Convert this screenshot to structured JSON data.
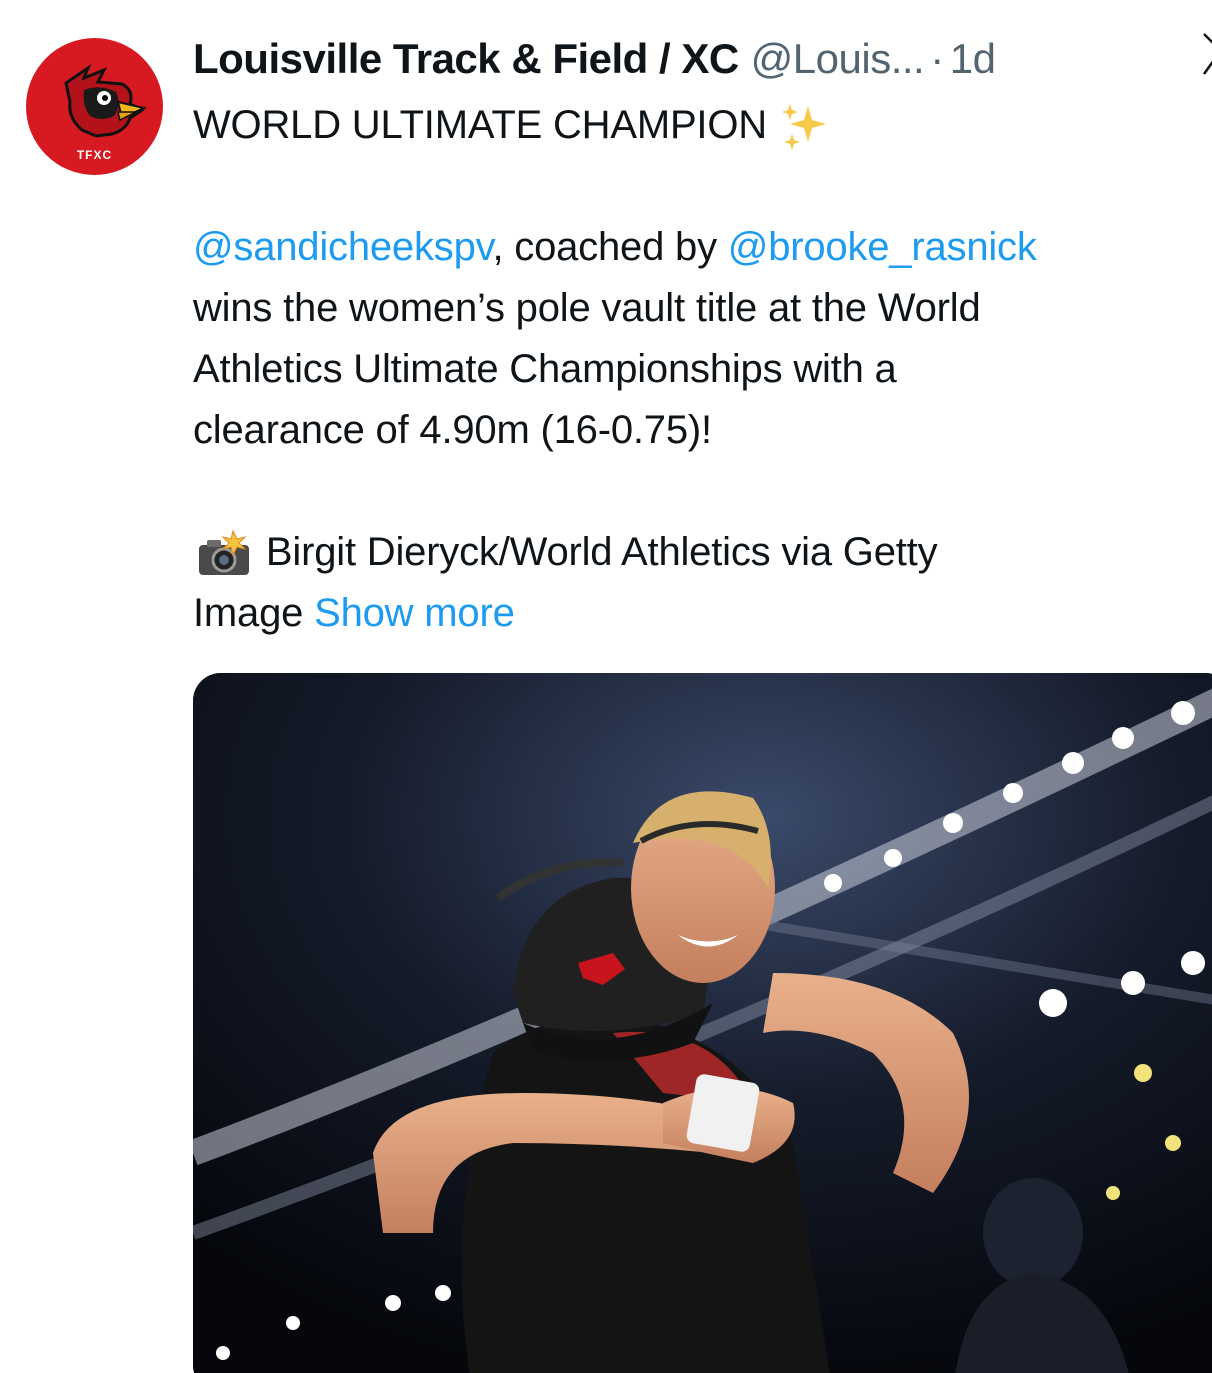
{
  "account": {
    "display_name": "Louisville Track & Field / XC",
    "handle": "@Louis...",
    "separator": "·",
    "time": "1d",
    "avatar_label": "TFXC"
  },
  "tweet": {
    "headline": "WORLD ULTIMATE CHAMPION",
    "mention_1": "@sandicheekspv",
    "coached_by": ", coached by ",
    "mention_2": "@brooke_rasnick",
    "line_2": "wins the women’s pole vault title at the World",
    "line_3": "Athletics Ultimate Championships with a",
    "line_4": "clearance of 4.90m (16-0.75)!",
    "credit_line_1": "Birgit Dieryck/World Athletics via Getty",
    "credit_line_2": "Image",
    "show_more": "Show more"
  },
  "icons": {
    "sparkles": "sparkles-icon",
    "camera": "camera-flash-icon",
    "more": "chevron-icon"
  },
  "colors": {
    "link": "#1d9bf0",
    "muted": "#536471",
    "brand_red": "#d71a21"
  }
}
